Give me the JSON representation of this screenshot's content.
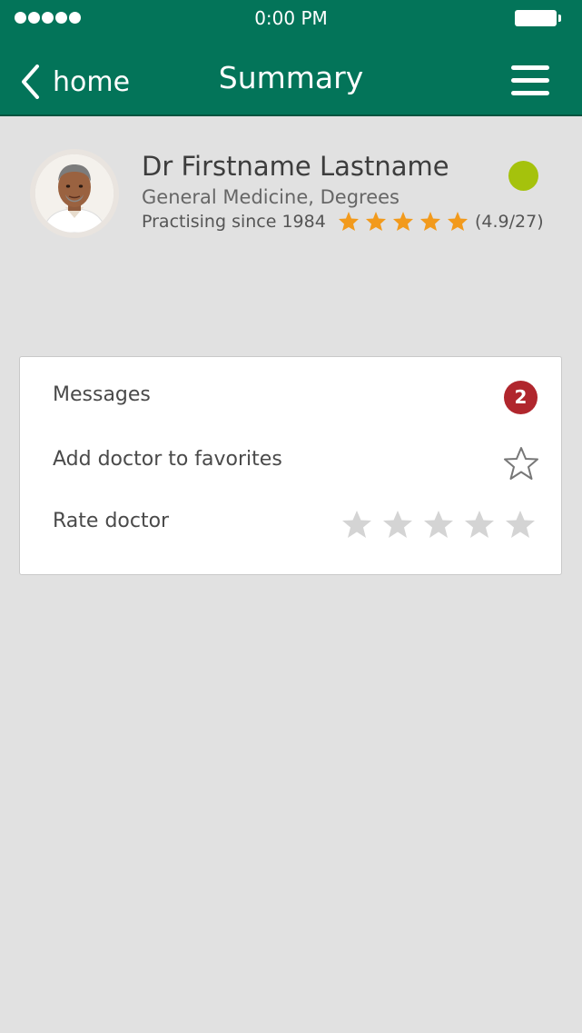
{
  "status_bar": {
    "time": "0:00 PM"
  },
  "header": {
    "back_label": "home",
    "title": "Summary"
  },
  "doctor": {
    "name": "Dr Firstname Lastname",
    "specialty": "General Medicine, Degrees",
    "practising": "Practising since 1984",
    "rating_stars": 5,
    "rating_text": "(4.9/27)",
    "online": true
  },
  "actions": {
    "messages_label": "Messages",
    "messages_count": "2",
    "favorites_label": "Add doctor to favorites",
    "rate_label": "Rate doctor",
    "rate_stars_total": 5,
    "rate_stars_selected": 0
  },
  "colors": {
    "header_bg": "#037459",
    "star_filled": "#f29a1c",
    "star_empty": "#d4d4d4",
    "badge_bg": "#b0262d",
    "online": "#a5c20c"
  },
  "icons": {
    "back": "chevron-left-icon",
    "menu": "hamburger-icon",
    "favorite": "star-outline-icon",
    "rating": "star-icon"
  }
}
